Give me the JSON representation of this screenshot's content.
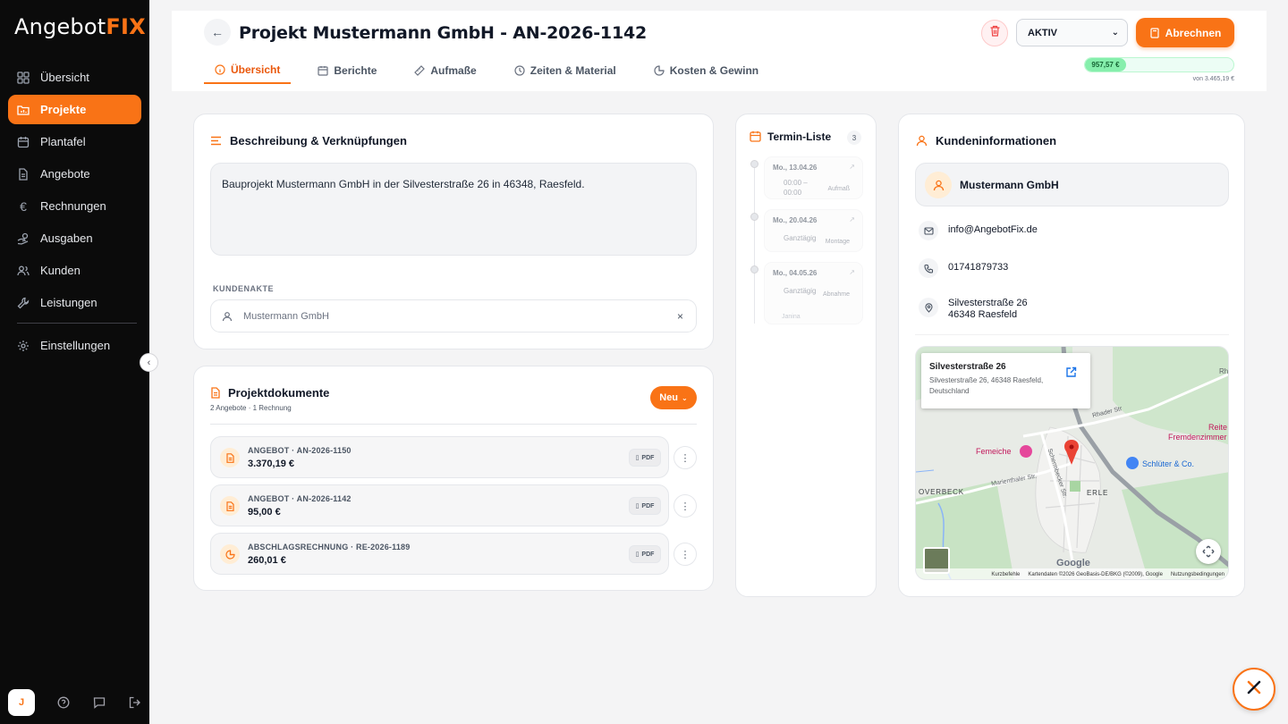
{
  "brand": {
    "logo_main": "Angebot",
    "logo_accent": "FIX"
  },
  "sidebar": {
    "items": [
      {
        "label": "Übersicht",
        "icon": "grid-icon"
      },
      {
        "label": "Projekte",
        "icon": "folder-chart-icon",
        "active": true
      },
      {
        "label": "Plantafel",
        "icon": "calendar-icon"
      },
      {
        "label": "Angebote",
        "icon": "document-icon"
      },
      {
        "label": "Rechnungen",
        "icon": "euro-icon"
      },
      {
        "label": "Ausgaben",
        "icon": "hand-coins-icon"
      },
      {
        "label": "Kunden",
        "icon": "users-icon"
      },
      {
        "label": "Leistungen",
        "icon": "wrench-icon"
      }
    ],
    "settings_label": "Einstellungen",
    "user_initial": "J"
  },
  "header": {
    "title": "Projekt Mustermann GmbH - AN-2026-1142",
    "tabs": [
      {
        "label": "Übersicht",
        "active": true
      },
      {
        "label": "Berichte"
      },
      {
        "label": "Aufmaße"
      },
      {
        "label": "Zeiten & Material"
      },
      {
        "label": "Kosten & Gewinn"
      }
    ],
    "status_value": "AKTIV",
    "bill_button": "Abrechnen",
    "progress": {
      "value_label": "957,57 €",
      "total_label": "von 3.465,19 €",
      "fraction": 0.277
    }
  },
  "description": {
    "title": "Beschreibung & Verknüpfungen",
    "text": "Bauprojekt Mustermann GmbH in der Silvesterstraße 26 in 46348, Raesfeld.",
    "kundenakte_label": "KUNDENAKTE",
    "kundenakte_value": "Mustermann GmbH",
    "clear_symbol": "×"
  },
  "documents": {
    "title": "Projektdokumente",
    "subtitle": "2 Angebote · 1 Rechnung",
    "new_button": "Neu",
    "pdf_label": "PDF",
    "items": [
      {
        "title": "ANGEBOT · AN-2026-1150",
        "amount": "3.370,19 €",
        "icon": "document-icon"
      },
      {
        "title": "ANGEBOT · AN-2026-1142",
        "amount": "95,00 €",
        "icon": "document-icon"
      },
      {
        "title": "ABSCHLAGSRECHNUNG · RE-2026-1189",
        "amount": "260,01 €",
        "icon": "pie-chart-icon"
      }
    ]
  },
  "termine": {
    "title": "Termin-Liste",
    "count": "3",
    "items": [
      {
        "date": "Mo., 13.04.26",
        "time": "00:00 –\n00:00",
        "tag": "Aufmaß"
      },
      {
        "date": "Mo., 20.04.26",
        "time": "Ganztägig",
        "tag": "Montage"
      },
      {
        "date": "Mo., 04.05.26",
        "time": "Ganztägig",
        "tag": "Abnahme",
        "person": "Janina"
      }
    ]
  },
  "kunde": {
    "title": "Kundeninformationen",
    "name": "Mustermann GmbH",
    "email": "info@AngebotFix.de",
    "phone": "01741879733",
    "street": "Silvesterstraße 26",
    "city": "46348 Raesfeld"
  },
  "map": {
    "popup_title": "Silvesterstraße 26",
    "popup_address": "Silvesterstraße 26, 46348 Raesfeld, Deutschland",
    "labels": {
      "femeiche": "Femeiche",
      "schlueter": "Schlüter & Co.",
      "overbeck": "OVERBECK",
      "erle": "ERLE",
      "rhader": "Rhader Str",
      "marienthaler": "Marienthaler Str.",
      "schermbecker": "Schermbecker Str.",
      "reite": "Reite",
      "fremdenzimmer": "Fremdenzimmer",
      "rh": "Rh"
    },
    "google": "Google",
    "footer": [
      "Kurzbefehle",
      "Kartendaten ©2026 GeoBasis-DE/BKG (©2009), Google",
      "Nutzungsbedingungen"
    ]
  },
  "colors": {
    "accent": "#f97316",
    "sidebar_bg": "#0b0b0b",
    "progress": "#86efac"
  }
}
